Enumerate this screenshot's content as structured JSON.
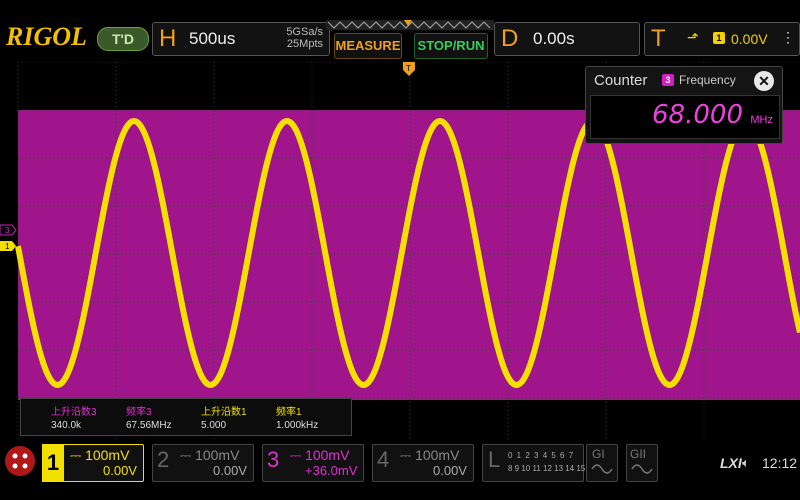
{
  "brand": {
    "logo": "RIGOL",
    "mode_pill": "T'D"
  },
  "horizontal": {
    "letter": "H",
    "timebase": "500us",
    "sample_rate": "5GSa/s",
    "memory_depth": "25Mpts"
  },
  "buttons": {
    "measure": "MEASURE",
    "stop_run": "STOP/RUN"
  },
  "delay": {
    "letter": "D",
    "value": "0.00s"
  },
  "trigger": {
    "letter": "T",
    "edge_icon": "rising-edge-icon",
    "source": "1",
    "level": "0.00V",
    "menu_icon": "more-icon"
  },
  "counter": {
    "title": "Counter",
    "source": "3",
    "label": "Frequency",
    "value": "68.000",
    "unit": "MHz",
    "close": "✕"
  },
  "left_markers": {
    "ch3": "3",
    "ch1": "1"
  },
  "measurements": {
    "headers": [
      "上升沿数3",
      "频率3",
      "上升沿数1",
      "频率1"
    ],
    "values": [
      "340.0k",
      "67.56MHz",
      "5.000",
      "1.000kHz"
    ]
  },
  "channels": [
    {
      "num": "1",
      "scale": "100mV",
      "offset": "0.00V"
    },
    {
      "num": "2",
      "scale": "100mV",
      "offset": "0.00V"
    },
    {
      "num": "3",
      "scale": "100mV",
      "offset": "+36.0mV"
    },
    {
      "num": "4",
      "scale": "100mV",
      "offset": "0.00V"
    }
  ],
  "logic": {
    "letter": "L",
    "row1": "0 1 2 3  4 5 6 7",
    "row2": "8 9 10 11 12 13 14 15"
  },
  "generators": {
    "g1": "GI",
    "g2": "GII"
  },
  "status": {
    "lxi": "LXI",
    "time": "12:12"
  },
  "colors": {
    "ch1": "#f4e000",
    "ch3": "#d020c0",
    "accent": "#f0a020",
    "run": "#33d05a"
  }
}
